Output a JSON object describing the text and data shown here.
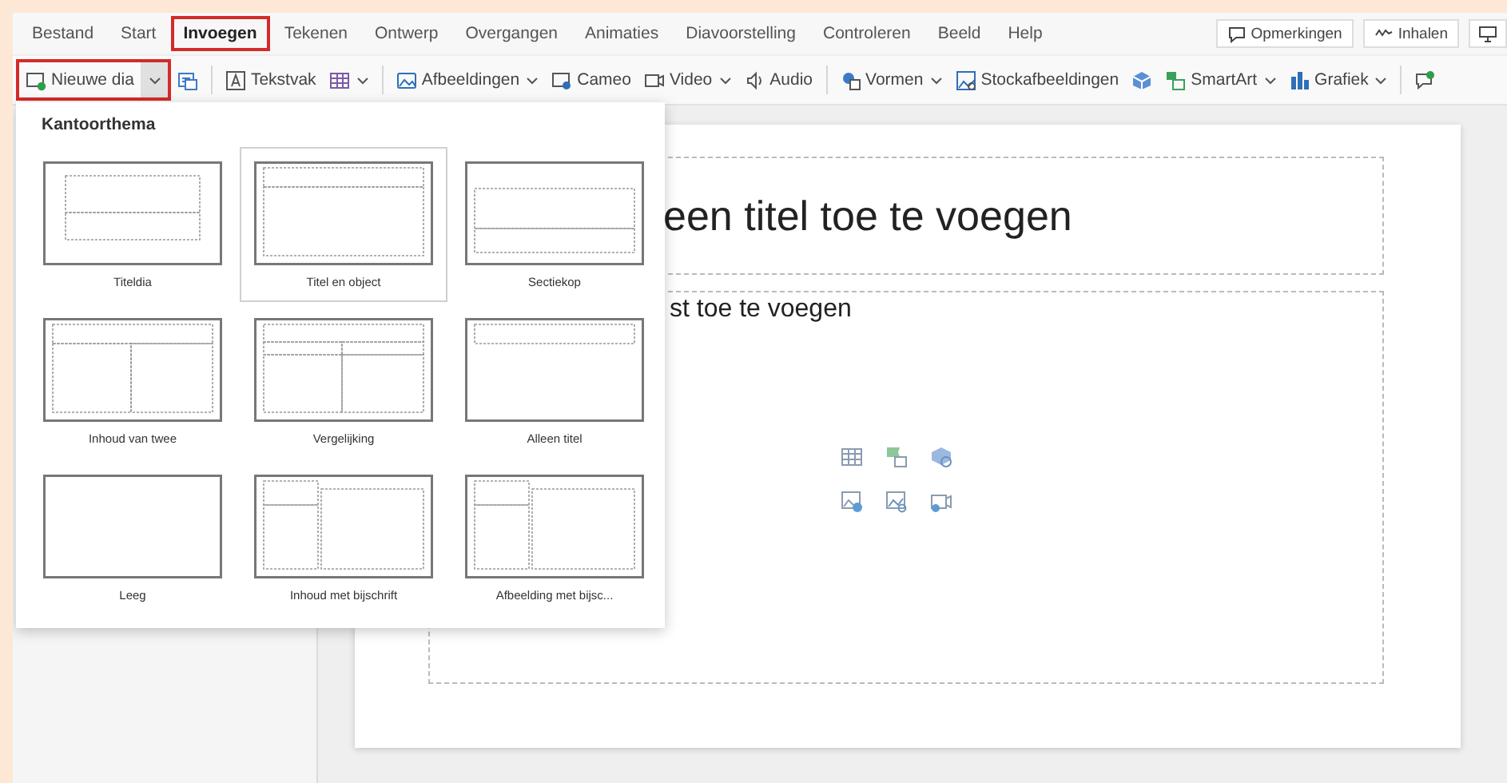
{
  "menu_tabs": [
    {
      "label": "Bestand",
      "selected": false,
      "highlighted": false
    },
    {
      "label": "Start",
      "selected": false,
      "highlighted": false
    },
    {
      "label": "Invoegen",
      "selected": true,
      "highlighted": true
    },
    {
      "label": "Tekenen",
      "selected": false,
      "highlighted": false
    },
    {
      "label": "Ontwerp",
      "selected": false,
      "highlighted": false
    },
    {
      "label": "Overgangen",
      "selected": false,
      "highlighted": false
    },
    {
      "label": "Animaties",
      "selected": false,
      "highlighted": false
    },
    {
      "label": "Diavoorstelling",
      "selected": false,
      "highlighted": false
    },
    {
      "label": "Controleren",
      "selected": false,
      "highlighted": false
    },
    {
      "label": "Beeld",
      "selected": false,
      "highlighted": false
    },
    {
      "label": "Help",
      "selected": false,
      "highlighted": false
    }
  ],
  "header_buttons": [
    {
      "label": "Opmerkingen"
    },
    {
      "label": "Inhalen"
    }
  ],
  "new_slide": {
    "label": "Nieuwe dia",
    "expanded": true,
    "highlighted": true
  },
  "toolbar_groups": [
    [
      {
        "has_menu": false
      }
    ],
    [
      {
        "label": "Tekstvak",
        "has_menu": false
      },
      {
        "has_menu": true
      }
    ],
    [
      {
        "label": "Afbeeldingen",
        "has_menu": true
      },
      {
        "label": "Cameo",
        "has_menu": false
      },
      {
        "label": "Video",
        "has_menu": true
      },
      {
        "label": "Audio",
        "has_menu": false
      }
    ],
    [
      {
        "label": "Vormen",
        "has_menu": true
      },
      {
        "label": "Stockafbeeldingen",
        "has_menu": false
      },
      {
        "has_menu": false
      },
      {
        "label": "SmartArt",
        "has_menu": true
      },
      {
        "label": "Grafiek",
        "has_menu": true
      }
    ],
    [
      {
        "has_menu": false
      }
    ]
  ],
  "layout_gallery": {
    "title": "Kantoorthema",
    "layouts": [
      {
        "label": "Titeldia",
        "kind": "title",
        "selected": false
      },
      {
        "label": "Titel en object",
        "kind": "content",
        "selected": true
      },
      {
        "label": "Sectiekop",
        "kind": "section",
        "selected": false
      },
      {
        "label": "Inhoud van twee",
        "kind": "two",
        "selected": false
      },
      {
        "label": "Vergelijking",
        "kind": "comparison",
        "selected": false
      },
      {
        "label": "Alleen titel",
        "kind": "titleonly",
        "selected": false
      },
      {
        "label": "Leeg",
        "kind": "blank",
        "selected": false
      },
      {
        "label": "Inhoud met bijschrift",
        "kind": "caption",
        "selected": false
      },
      {
        "label": "Afbeelding met bijsc...",
        "kind": "caption",
        "selected": false
      }
    ]
  },
  "slide": {
    "title_placeholder": "een titel toe te voegen",
    "body_placeholder": "st toe te voegen"
  }
}
